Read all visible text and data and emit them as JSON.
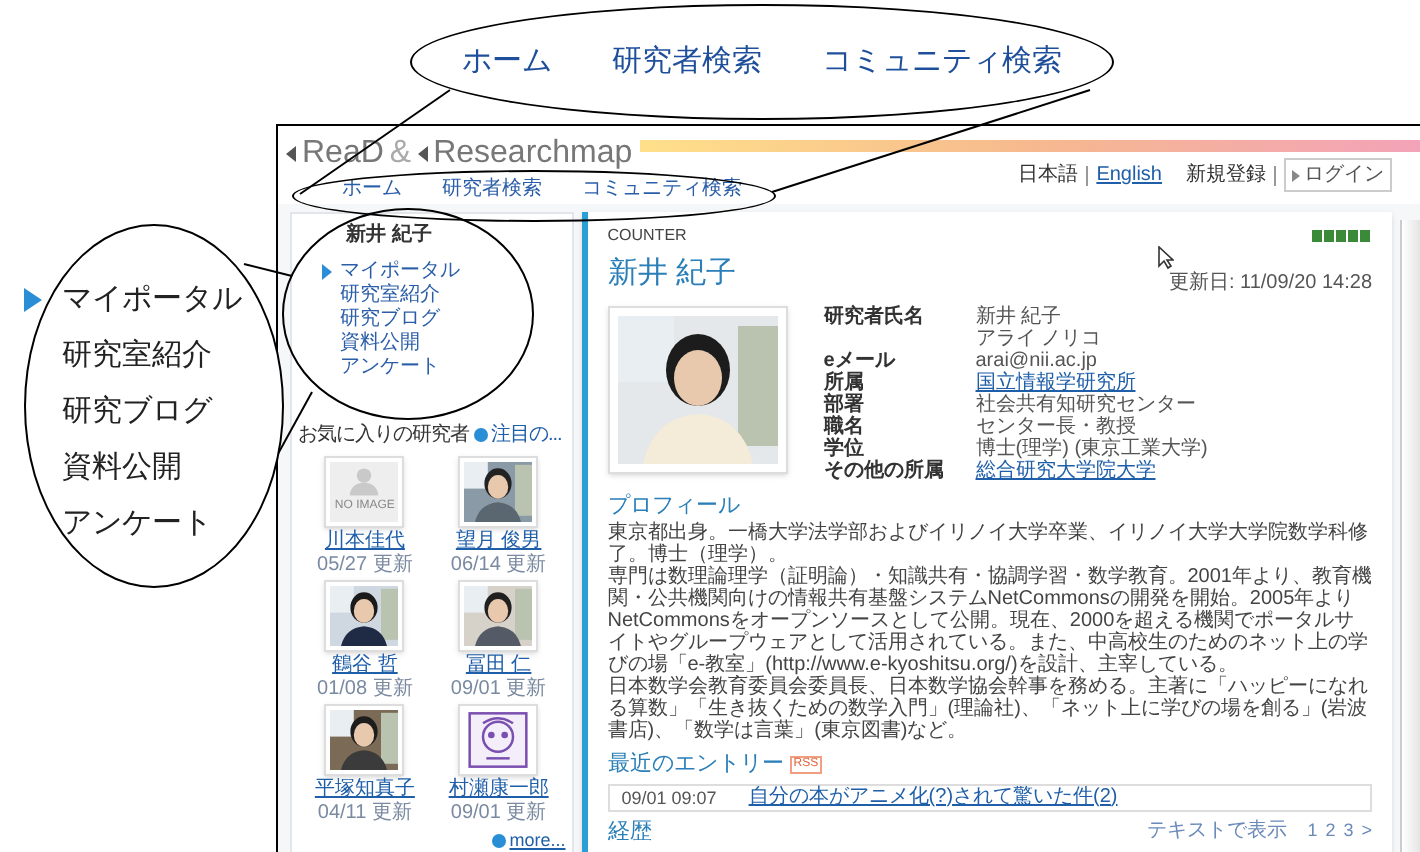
{
  "callouts": {
    "top_nav": [
      "ホーム",
      "研究者検索",
      "コミュニティ検索"
    ],
    "side_menu": [
      {
        "label": "マイポータル",
        "selected": true
      },
      {
        "label": "研究室紹介",
        "selected": false
      },
      {
        "label": "研究ブログ",
        "selected": false
      },
      {
        "label": "資料公開",
        "selected": false
      },
      {
        "label": "アンケート",
        "selected": false
      }
    ]
  },
  "header": {
    "logo_first": "ReaD",
    "logo_separator": "&",
    "logo_second": "Researchmap",
    "languages": [
      {
        "label": "日本語",
        "selected": true
      },
      {
        "label": "English",
        "selected": false
      }
    ],
    "register": "新規登録",
    "login": "ログイン"
  },
  "nav": [
    "ホーム",
    "研究者検索",
    "コミュニティ検索"
  ],
  "sidebar": {
    "owner": "新井 紀子",
    "menu": [
      {
        "label": "マイポータル",
        "selected": true
      },
      {
        "label": "研究室紹介",
        "selected": false
      },
      {
        "label": "研究ブログ",
        "selected": false
      },
      {
        "label": "資料公開",
        "selected": false
      },
      {
        "label": "アンケート",
        "selected": false
      }
    ],
    "favorites_title": "お気に入りの研究者",
    "favorites_action": "注目の...",
    "researchers": [
      {
        "kind": "no_image",
        "image_text": "NO IMAGE",
        "name": "川本佳代",
        "date": "05/27 更新"
      },
      {
        "name": "望月 俊男",
        "date": "06/14 更新"
      },
      {
        "name": "鶴谷 哲",
        "date": "01/08 更新"
      },
      {
        "name": "冨田 仁",
        "date": "09/01 更新"
      },
      {
        "name": "平塚知真子",
        "date": "04/11 更新"
      },
      {
        "kind": "illustration",
        "name": "村瀬康一郎",
        "date": "09/01 更新"
      }
    ],
    "more": "more..."
  },
  "profile": {
    "counter_label": "COUNTER",
    "name": "新井 紀子",
    "updated": "更新日: 11/09/20 14:28",
    "fields": [
      {
        "label": "研究者氏名",
        "values": [
          {
            "text": "新井 紀子",
            "link": false
          },
          {
            "text": "アライ ノリコ",
            "link": false
          }
        ]
      },
      {
        "label": "eメール",
        "values": [
          {
            "text": "arai@nii.ac.jp",
            "link": false
          }
        ]
      },
      {
        "label": "所属",
        "values": [
          {
            "text": "国立情報学研究所",
            "link": true
          }
        ]
      },
      {
        "label": "部署",
        "values": [
          {
            "text": "社会共有知研究センター",
            "link": false
          }
        ]
      },
      {
        "label": "職名",
        "values": [
          {
            "text": "センター長・教授",
            "link": false
          }
        ]
      },
      {
        "label": "学位",
        "values": [
          {
            "text": "博士(理学) (東京工業大学)",
            "link": false
          }
        ]
      },
      {
        "label": "その他の所属",
        "values": [
          {
            "text": "総合研究大学院大学",
            "link": true
          }
        ]
      }
    ],
    "profile_title": "プロフィール",
    "profile_paragraphs": [
      "東京都出身。一橋大学法学部およびイリノイ大学卒業、イリノイ大学大学院数学科修了。博士（理学）。",
      "専門は数理論理学（証明論）・知識共有・協調学習・数学教育。2001年より、教育機関・公共機関向けの情報共有基盤システムNetCommonsの開発を開始。2005年よりNetCommonsをオープンソースとして公開。現在、2000を超える機関でポータルサイトやグループウェアとして活用されている。また、中高校生のためのネット上の学びの場「e-教室」(http://www.e-kyoshitsu.org/)を設計、主宰している。",
      "日本数学会教育委員会委員長、日本数学協会幹事を務める。主著に「ハッピーになれる算数」「生き抜くための数学入門」(理論社)、「ネット上に学びの場を創る」(岩波書店)、「数学は言葉」(東京図書)など。"
    ],
    "entries_title": "最近のエントリー",
    "rss": "RSS",
    "entries": [
      {
        "date": "09/01 09:07",
        "title": "自分の本がアニメ化(?)されて驚いた件(2)"
      }
    ],
    "career_title": "経歴",
    "text_view": "テキストで表示",
    "pages": [
      "1",
      "2",
      "3",
      ">"
    ]
  }
}
